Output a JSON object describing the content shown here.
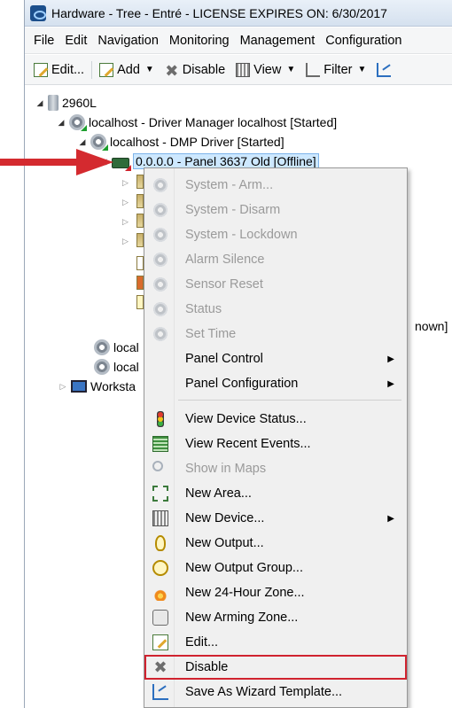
{
  "window": {
    "title": "Hardware - Tree - Entré - LICENSE EXPIRES ON: 6/30/2017"
  },
  "menubar": {
    "items": [
      "File",
      "Edit",
      "Navigation",
      "Monitoring",
      "Management",
      "Configuration"
    ]
  },
  "toolbar": {
    "edit_label": "Edit...",
    "add_label": "Add",
    "disable_label": "Disable",
    "view_label": "View",
    "filter_label": "Filter"
  },
  "tree": {
    "root": "2960L",
    "driver_manager": "localhost - Driver Manager localhost [Started]",
    "dmp_driver": "localhost - DMP Driver [Started]",
    "panel": "0.0.0.0 - Panel 3637 Old [Offline]",
    "partial_right_text": "nown]",
    "local_1": "local",
    "local_2": "local",
    "workstation": "Worksta"
  },
  "context_menu": {
    "items": [
      {
        "label": "System - Arm...",
        "icon": "gear-disabled-icon",
        "enabled": false
      },
      {
        "label": "System - Disarm",
        "icon": "gear-disabled-icon",
        "enabled": false
      },
      {
        "label": "System - Lockdown",
        "icon": "gear-disabled-icon",
        "enabled": false
      },
      {
        "label": "Alarm Silence",
        "icon": "gear-disabled-icon",
        "enabled": false
      },
      {
        "label": "Sensor Reset",
        "icon": "gear-disabled-icon",
        "enabled": false
      },
      {
        "label": "Status",
        "icon": "gear-disabled-icon",
        "enabled": false
      },
      {
        "label": "Set Time",
        "icon": "gear-disabled-icon",
        "enabled": false
      },
      {
        "label": "Panel Control",
        "submenu": true,
        "enabled": true
      },
      {
        "label": "Panel Configuration",
        "submenu": true,
        "enabled": true
      },
      {
        "label": "View Device Status...",
        "icon": "traffic-light-icon",
        "enabled": true
      },
      {
        "label": "View Recent Events...",
        "icon": "events-list-icon",
        "enabled": true
      },
      {
        "label": "Show in Maps",
        "icon": "magnifier-icon",
        "enabled": false
      },
      {
        "label": "New Area...",
        "icon": "area-icon",
        "enabled": true
      },
      {
        "label": "New Device...",
        "icon": "device-icon",
        "submenu": true,
        "enabled": true
      },
      {
        "label": "New Output...",
        "icon": "bulb-icon",
        "enabled": true
      },
      {
        "label": "New Output Group...",
        "icon": "bulb-group-icon",
        "enabled": true
      },
      {
        "label": "New 24-Hour Zone...",
        "icon": "flame-icon",
        "enabled": true
      },
      {
        "label": "New Arming Zone...",
        "icon": "arming-zone-icon",
        "enabled": true
      },
      {
        "label": "Edit...",
        "icon": "edit-icon",
        "enabled": true
      },
      {
        "label": "Disable",
        "icon": "x-icon",
        "enabled": true,
        "highlighted": true
      },
      {
        "label": "Save As Wizard Template...",
        "icon": "wizard-icon",
        "enabled": true
      }
    ]
  },
  "colors": {
    "highlight_outline": "#d0232f",
    "arrow": "#d42a2f",
    "selection": "#cde8ff"
  }
}
